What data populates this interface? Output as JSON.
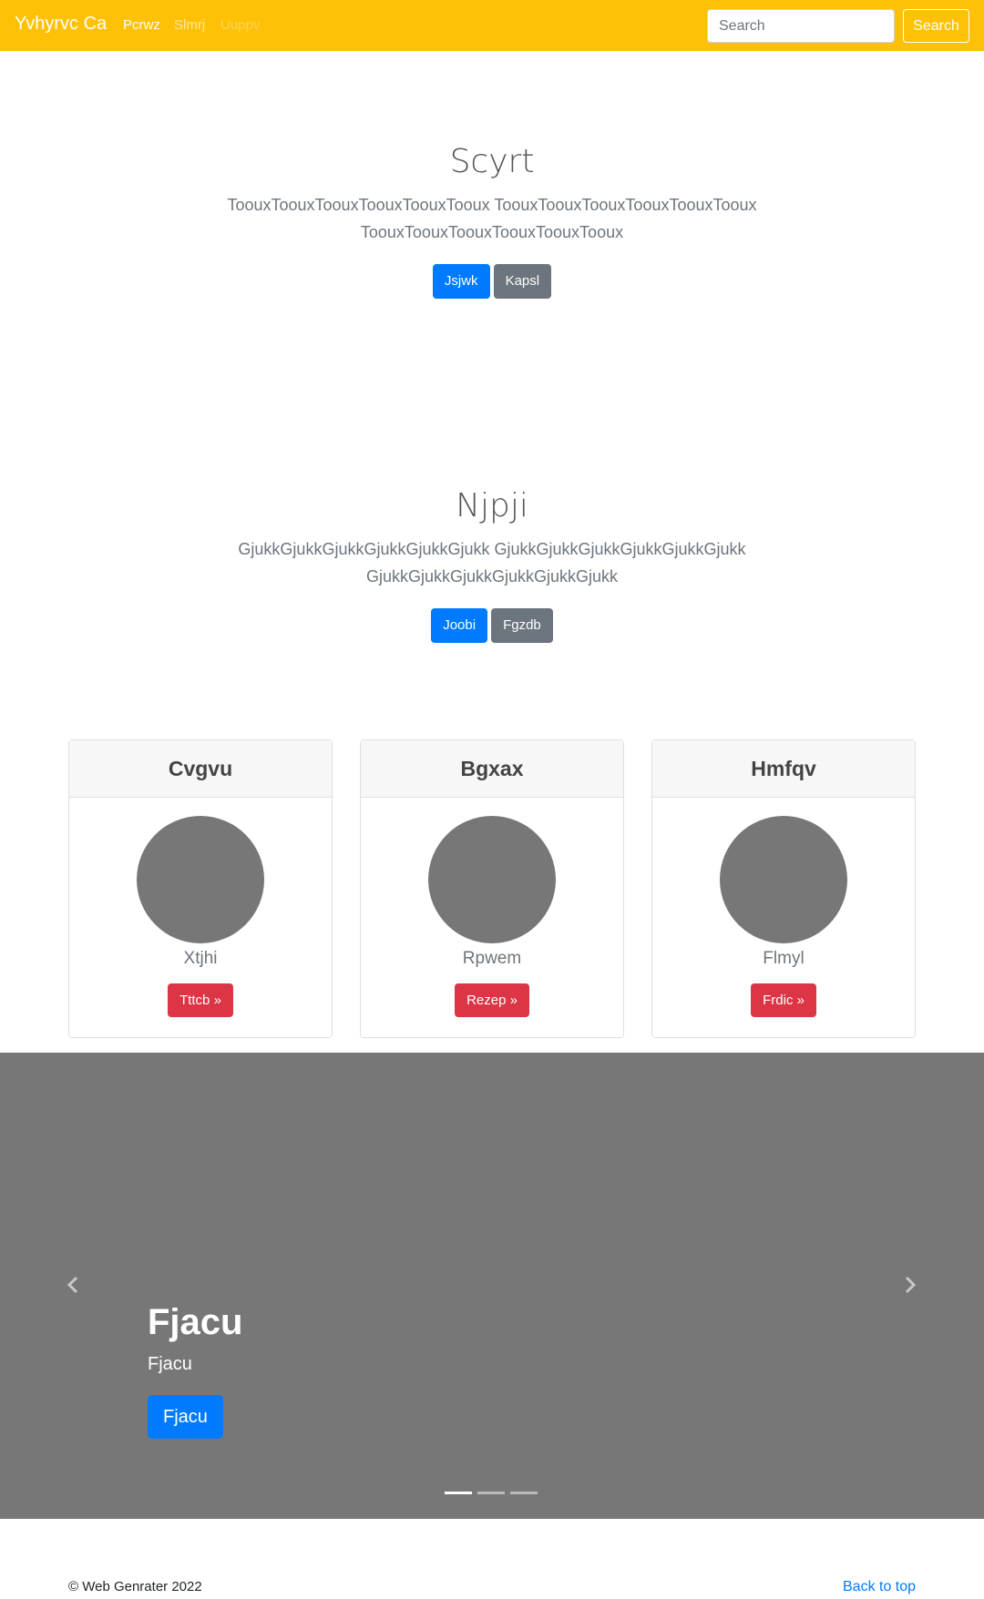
{
  "navbar": {
    "brand": "Yvhyrvc Ca",
    "links": [
      "Pcrwz",
      "Slmrj",
      "Uuppv"
    ],
    "search_placeholder": "Search",
    "search_button": "Search",
    "bg_color": "#ffc107"
  },
  "hero1": {
    "title": "Scyrt",
    "lead": "ToouxToouxToouxToouxToouxTooux ToouxToouxToouxToouxToouxTooux ToouxToouxToouxToouxToouxTooux",
    "primary_button": "Jsjwk",
    "secondary_button": "Kapsl"
  },
  "hero2": {
    "title": "Njpji",
    "lead": "GjukkGjukkGjukkGjukkGjukkGjukk GjukkGjukkGjukkGjukkGjukkGjukk GjukkGjukkGjukkGjukkGjukkGjukk",
    "primary_button": "Joobi",
    "secondary_button": "Fgzdb"
  },
  "cards": [
    {
      "header": "Cvgvu",
      "text": "Xtjhi",
      "button": "Tttcb »"
    },
    {
      "header": "Bgxax",
      "text": "Rpwem",
      "button": "Rezep »"
    },
    {
      "header": "Hmfqv",
      "text": "Flmyl",
      "button": "Frdic »"
    }
  ],
  "carousel": {
    "title": "Fjacu",
    "text": "Fjacu",
    "button": "Fjacu",
    "prev_icon": "chevron-left-icon",
    "next_icon": "chevron-right-icon",
    "slides": 3,
    "active_slide": 1
  },
  "footer": {
    "copyright": "© Web Genrater 2022",
    "back_to_top": "Back to top"
  }
}
